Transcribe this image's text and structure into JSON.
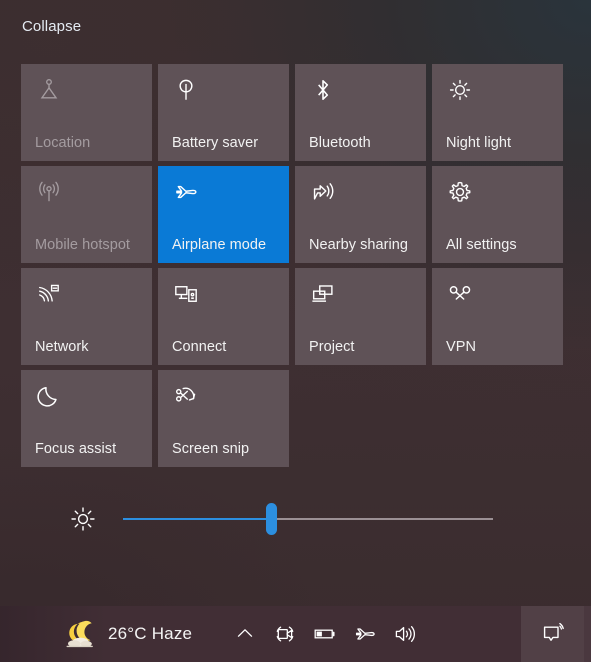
{
  "panel": {
    "collapse_label": "Collapse",
    "background_color": "#3a2c2e",
    "tile_color": "#5f5257",
    "tile_active_color": "#0a7ad6",
    "disabled_text_color": "#a49ca0"
  },
  "tiles": [
    {
      "label": "Location",
      "icon": "location-icon",
      "state": "disabled"
    },
    {
      "label": "Battery saver",
      "icon": "battery-saver-icon",
      "state": "off"
    },
    {
      "label": "Bluetooth",
      "icon": "bluetooth-icon",
      "state": "off"
    },
    {
      "label": "Night light",
      "icon": "night-light-icon",
      "state": "off"
    },
    {
      "label": "Mobile hotspot",
      "icon": "mobile-hotspot-icon",
      "state": "disabled"
    },
    {
      "label": "Airplane mode",
      "icon": "airplane-icon",
      "state": "on"
    },
    {
      "label": "Nearby sharing",
      "icon": "nearby-sharing-icon",
      "state": "off"
    },
    {
      "label": "All settings",
      "icon": "gear-icon",
      "state": "off"
    },
    {
      "label": "Network",
      "icon": "network-icon",
      "state": "off"
    },
    {
      "label": "Connect",
      "icon": "connect-icon",
      "state": "off"
    },
    {
      "label": "Project",
      "icon": "project-icon",
      "state": "off"
    },
    {
      "label": "VPN",
      "icon": "vpn-icon",
      "state": "off"
    },
    {
      "label": "Focus assist",
      "icon": "moon-icon",
      "state": "off"
    },
    {
      "label": "Screen snip",
      "icon": "screen-snip-icon",
      "state": "off"
    }
  ],
  "brightness": {
    "icon": "brightness-icon",
    "value_percent": 40,
    "fill_color": "#2c8fe0",
    "track_color": "#9b9094"
  },
  "taskbar": {
    "weather": {
      "icon": "moon-haze-icon",
      "text": "26°C  Haze"
    },
    "tray_icons": [
      {
        "name": "chevron-up-icon"
      },
      {
        "name": "meet-now-icon"
      },
      {
        "name": "battery-icon"
      },
      {
        "name": "airplane-icon"
      },
      {
        "name": "volume-icon"
      }
    ],
    "action_center": {
      "icon": "action-center-icon"
    }
  }
}
